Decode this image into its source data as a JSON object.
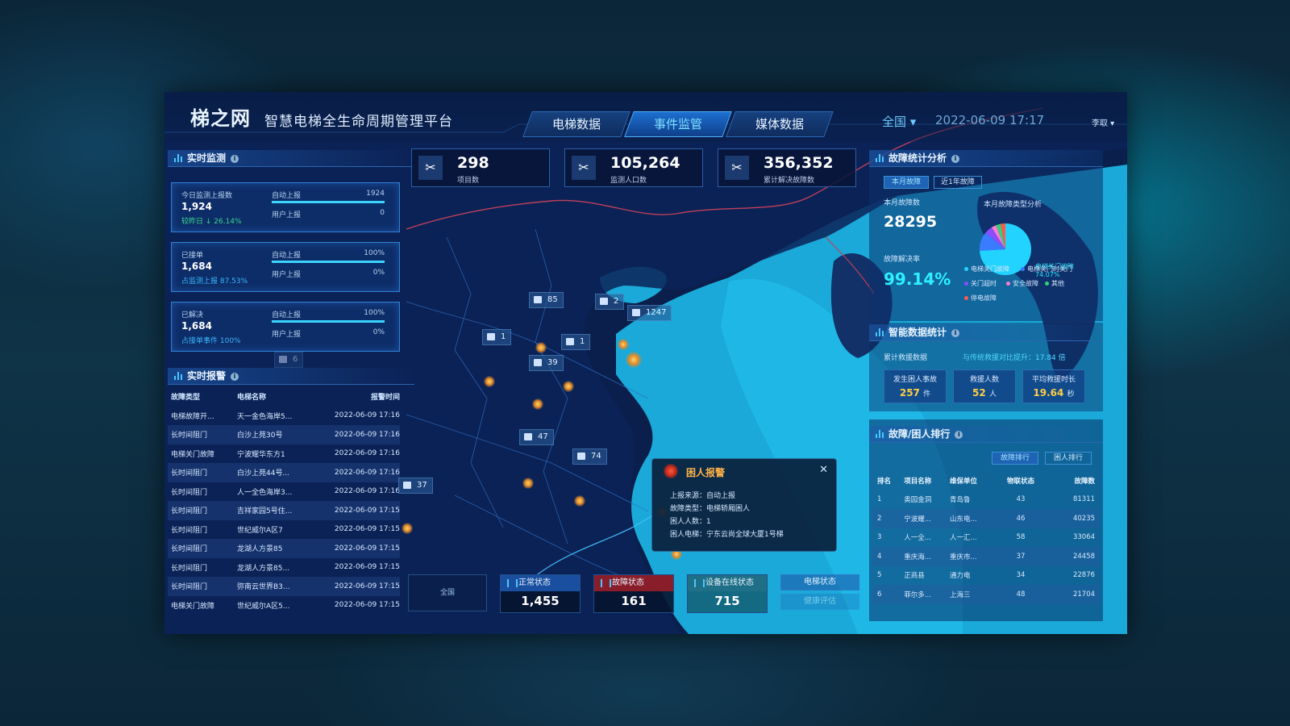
{
  "header": {
    "logo": "梯之网",
    "subtitle": "智慧电梯全生命周期管理平台",
    "tabs": [
      "电梯数据",
      "事件监管",
      "媒体数据"
    ],
    "region": "全国 ▾",
    "datetime": "2022-06-09 17:17",
    "user": "李取 ▾"
  },
  "left": {
    "monitor_title": "实时监测",
    "cards": [
      {
        "label": "今日监测上报数",
        "value": "1,924",
        "sub": "较昨日 ↓ 26.14%",
        "r1": "自动上报",
        "r1v": "1924",
        "r2": "用户上报",
        "r2v": "0",
        "progress": 1.0
      },
      {
        "label": "已接单",
        "value": "1,684",
        "sub": "占监测上报 87.53%",
        "r1": "自动上报",
        "r1v": "100%",
        "r2": "用户上报",
        "r2v": "0%",
        "progress": 1.0
      },
      {
        "label": "已解决",
        "value": "1,684",
        "sub": "占接单事件 100%",
        "r1": "自动上报",
        "r1v": "100%",
        "r2": "用户上报",
        "r2v": "0%",
        "progress": 1.0
      }
    ],
    "report_title": "实时报警",
    "report_headers": [
      "故障类型",
      "电梯名称",
      "报警时间"
    ],
    "reports": [
      [
        "电梯故障开...",
        "天一金色海岸5...",
        "2022-06-09 17:16"
      ],
      [
        "长时间阻门",
        "白沙上苑30号",
        "2022-06-09 17:16"
      ],
      [
        "电梯关门故障",
        "宁波耀华东方1",
        "2022-06-09 17:16"
      ],
      [
        "长时间阻门",
        "白沙上苑44号...",
        "2022-06-09 17:16"
      ],
      [
        "长时间阻门",
        "人一全色海岸3...",
        "2022-06-09 17:16"
      ],
      [
        "长时间阻门",
        "吉祥家园5号住...",
        "2022-06-09 17:15"
      ],
      [
        "长时间阻门",
        "世纪威尔A区7",
        "2022-06-09 17:15"
      ],
      [
        "长时间阻门",
        "龙湖人方景85",
        "2022-06-09 17:15"
      ],
      [
        "长时间阻门",
        "龙湖人方景85...",
        "2022-06-09 17:15"
      ],
      [
        "长时间阻门",
        "弥南云世界B3...",
        "2022-06-09 17:15"
      ],
      [
        "电梯关门故障",
        "世纪威尔A区5...",
        "2022-06-09 17:15"
      ]
    ]
  },
  "kpis": [
    {
      "value": "298",
      "label": "项目数",
      "icon": "wrench-icon"
    },
    {
      "value": "105,264",
      "label": "监测人口数",
      "icon": "wrench-icon"
    },
    {
      "value": "356,352",
      "label": "累计解决故障数",
      "icon": "wrench-icon"
    }
  ],
  "map": {
    "markers": [
      "85",
      "2",
      "1247",
      "1",
      "1",
      "39",
      "47",
      "74",
      "37",
      "6"
    ],
    "popup": {
      "title": "困人报警",
      "lines": [
        "上报来源：自动上报",
        "故障类型：电梯轿厢困人",
        "困人人数：1",
        "困人电梯：宁东云尚全球大厦1号梯"
      ]
    },
    "status": [
      {
        "label": "正常状态",
        "value": "1,455",
        "color": "#1a4fa0"
      },
      {
        "label": "故障状态",
        "value": "161",
        "color": "#8a1d2a"
      },
      {
        "label": "设备在线状态",
        "value": "715",
        "color": "#1f6f86"
      }
    ],
    "buttons": [
      "电梯状态",
      "健康评估"
    ],
    "legend_label": "全国"
  },
  "right": {
    "fault_title": "故障统计分析",
    "tabs": [
      "本月故障",
      "近1年故障"
    ],
    "month_label": "本月故障数",
    "month_value": "28295",
    "rate_label": "故障解决率",
    "rate_value": "99.14%",
    "pie_title": "本月故障类型分析",
    "pie_callout": "电梯关门故障 74.07%",
    "legend": [
      {
        "label": "电梯关门故障",
        "color": "#23d3ff"
      },
      {
        "label": "电梯关门时关门",
        "color": "#3a7cff"
      },
      {
        "label": "关门超时",
        "color": "#8a4dff"
      },
      {
        "label": "安全故障",
        "color": "#ff7bd0"
      },
      {
        "label": "其他",
        "color": "#33d17a"
      },
      {
        "label": "停电故障",
        "color": "#ff5a4a"
      }
    ],
    "smart_title": "智能数据统计",
    "smart_left": "累计救援数据",
    "smart_right": "与传统救援对比提升：17.84 倍",
    "boxes": [
      {
        "label": "发生困人事故",
        "value": "257",
        "unit": "件"
      },
      {
        "label": "救援人数",
        "value": "52",
        "unit": "人"
      },
      {
        "label": "平均救援时长",
        "value": "19.64",
        "unit": "秒"
      }
    ],
    "rank_title": "故障/困人排行",
    "rank_tabs": [
      "故障排行",
      "困人排行"
    ],
    "rank_headers": [
      "排名",
      "项目名称",
      "维保单位",
      "物联状态",
      "故障数"
    ],
    "ranks": [
      [
        "1",
        "奥园金洞",
        "青岛鲁",
        "43",
        "81311"
      ],
      [
        "2",
        "宁波耀...",
        "山东电...",
        "46",
        "40235"
      ],
      [
        "3",
        "人一全...",
        "人一汇...",
        "58",
        "33064"
      ],
      [
        "4",
        "重庆海...",
        "重庆市...",
        "37",
        "24458"
      ],
      [
        "5",
        "正商县",
        "通力电",
        "34",
        "22876"
      ],
      [
        "6",
        "菲尔多...",
        "上海三",
        "48",
        "21704"
      ]
    ]
  }
}
